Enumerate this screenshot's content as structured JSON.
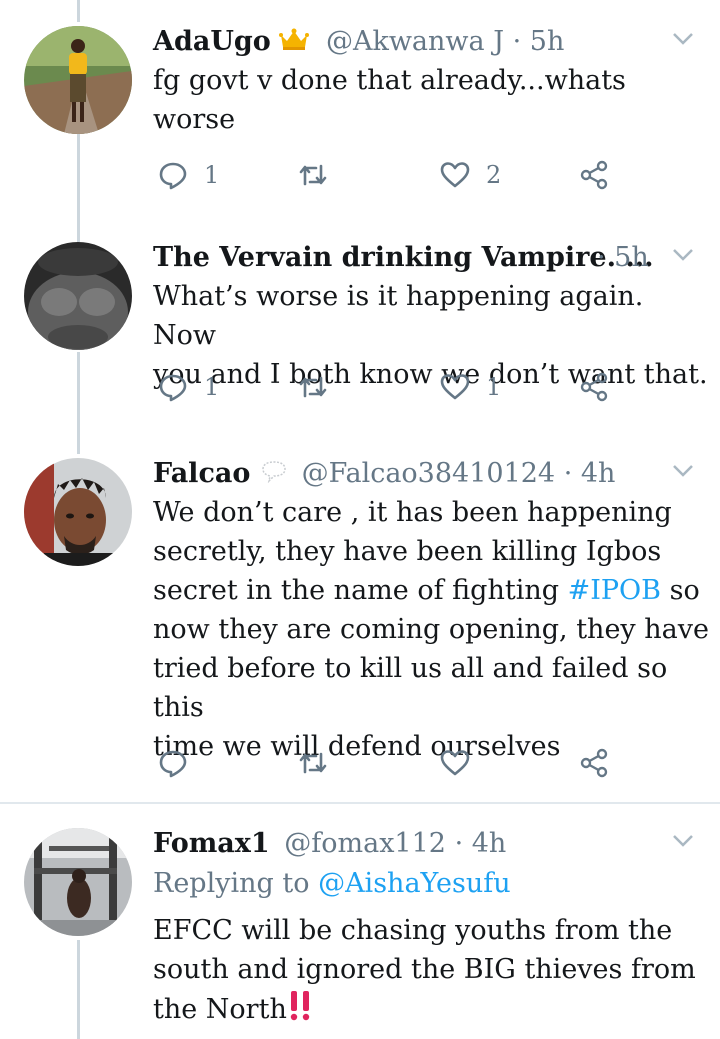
{
  "tweets": [
    {
      "name": "AdaUgo",
      "name_emoji": "crown-icon",
      "handle": "@Akwanwa J",
      "time": "· 5h",
      "text": "fg govt v done that already...whats\nworse",
      "replies": "1",
      "retweets": "",
      "likes": "2"
    },
    {
      "name": "The Vervain drinking Vampire. ...",
      "handle": "",
      "time": "· 5h",
      "text": "What’s worse is it happening again. Now\nyou and I both know we don’t want that.",
      "replies": "1",
      "retweets": "",
      "likes": "1"
    },
    {
      "name": "Falcao",
      "name_emoji": "speech-balloon-icon",
      "handle": "@Falcao38410124",
      "time": "· 4h",
      "text_before": "We don’t care , it has been happening\nsecretly, they have been killing Igbos\nsecret in the name of fighting ",
      "hashtag": "#IPOB",
      "text_after": " so\nnow they are coming opening, they have\ntried before to kill us all and failed so this\ntime we will defend ourselves",
      "replies": "",
      "retweets": "",
      "likes": ""
    },
    {
      "name": "Fomax1",
      "handle": "@fomax112",
      "time": "· 4h",
      "replying_prefix": "Replying to ",
      "replying_to": "@AishaYesufu",
      "text": "EFCC will be chasing youths from the\nsouth and ignored the BIG thieves from\nthe North",
      "text_emoji": "double-exclamation-icon"
    }
  ],
  "colors": {
    "accent": "#1da1f2",
    "muted": "#657786",
    "thread_line": "#ccd6dd",
    "emoji_red": "#e0245e"
  }
}
